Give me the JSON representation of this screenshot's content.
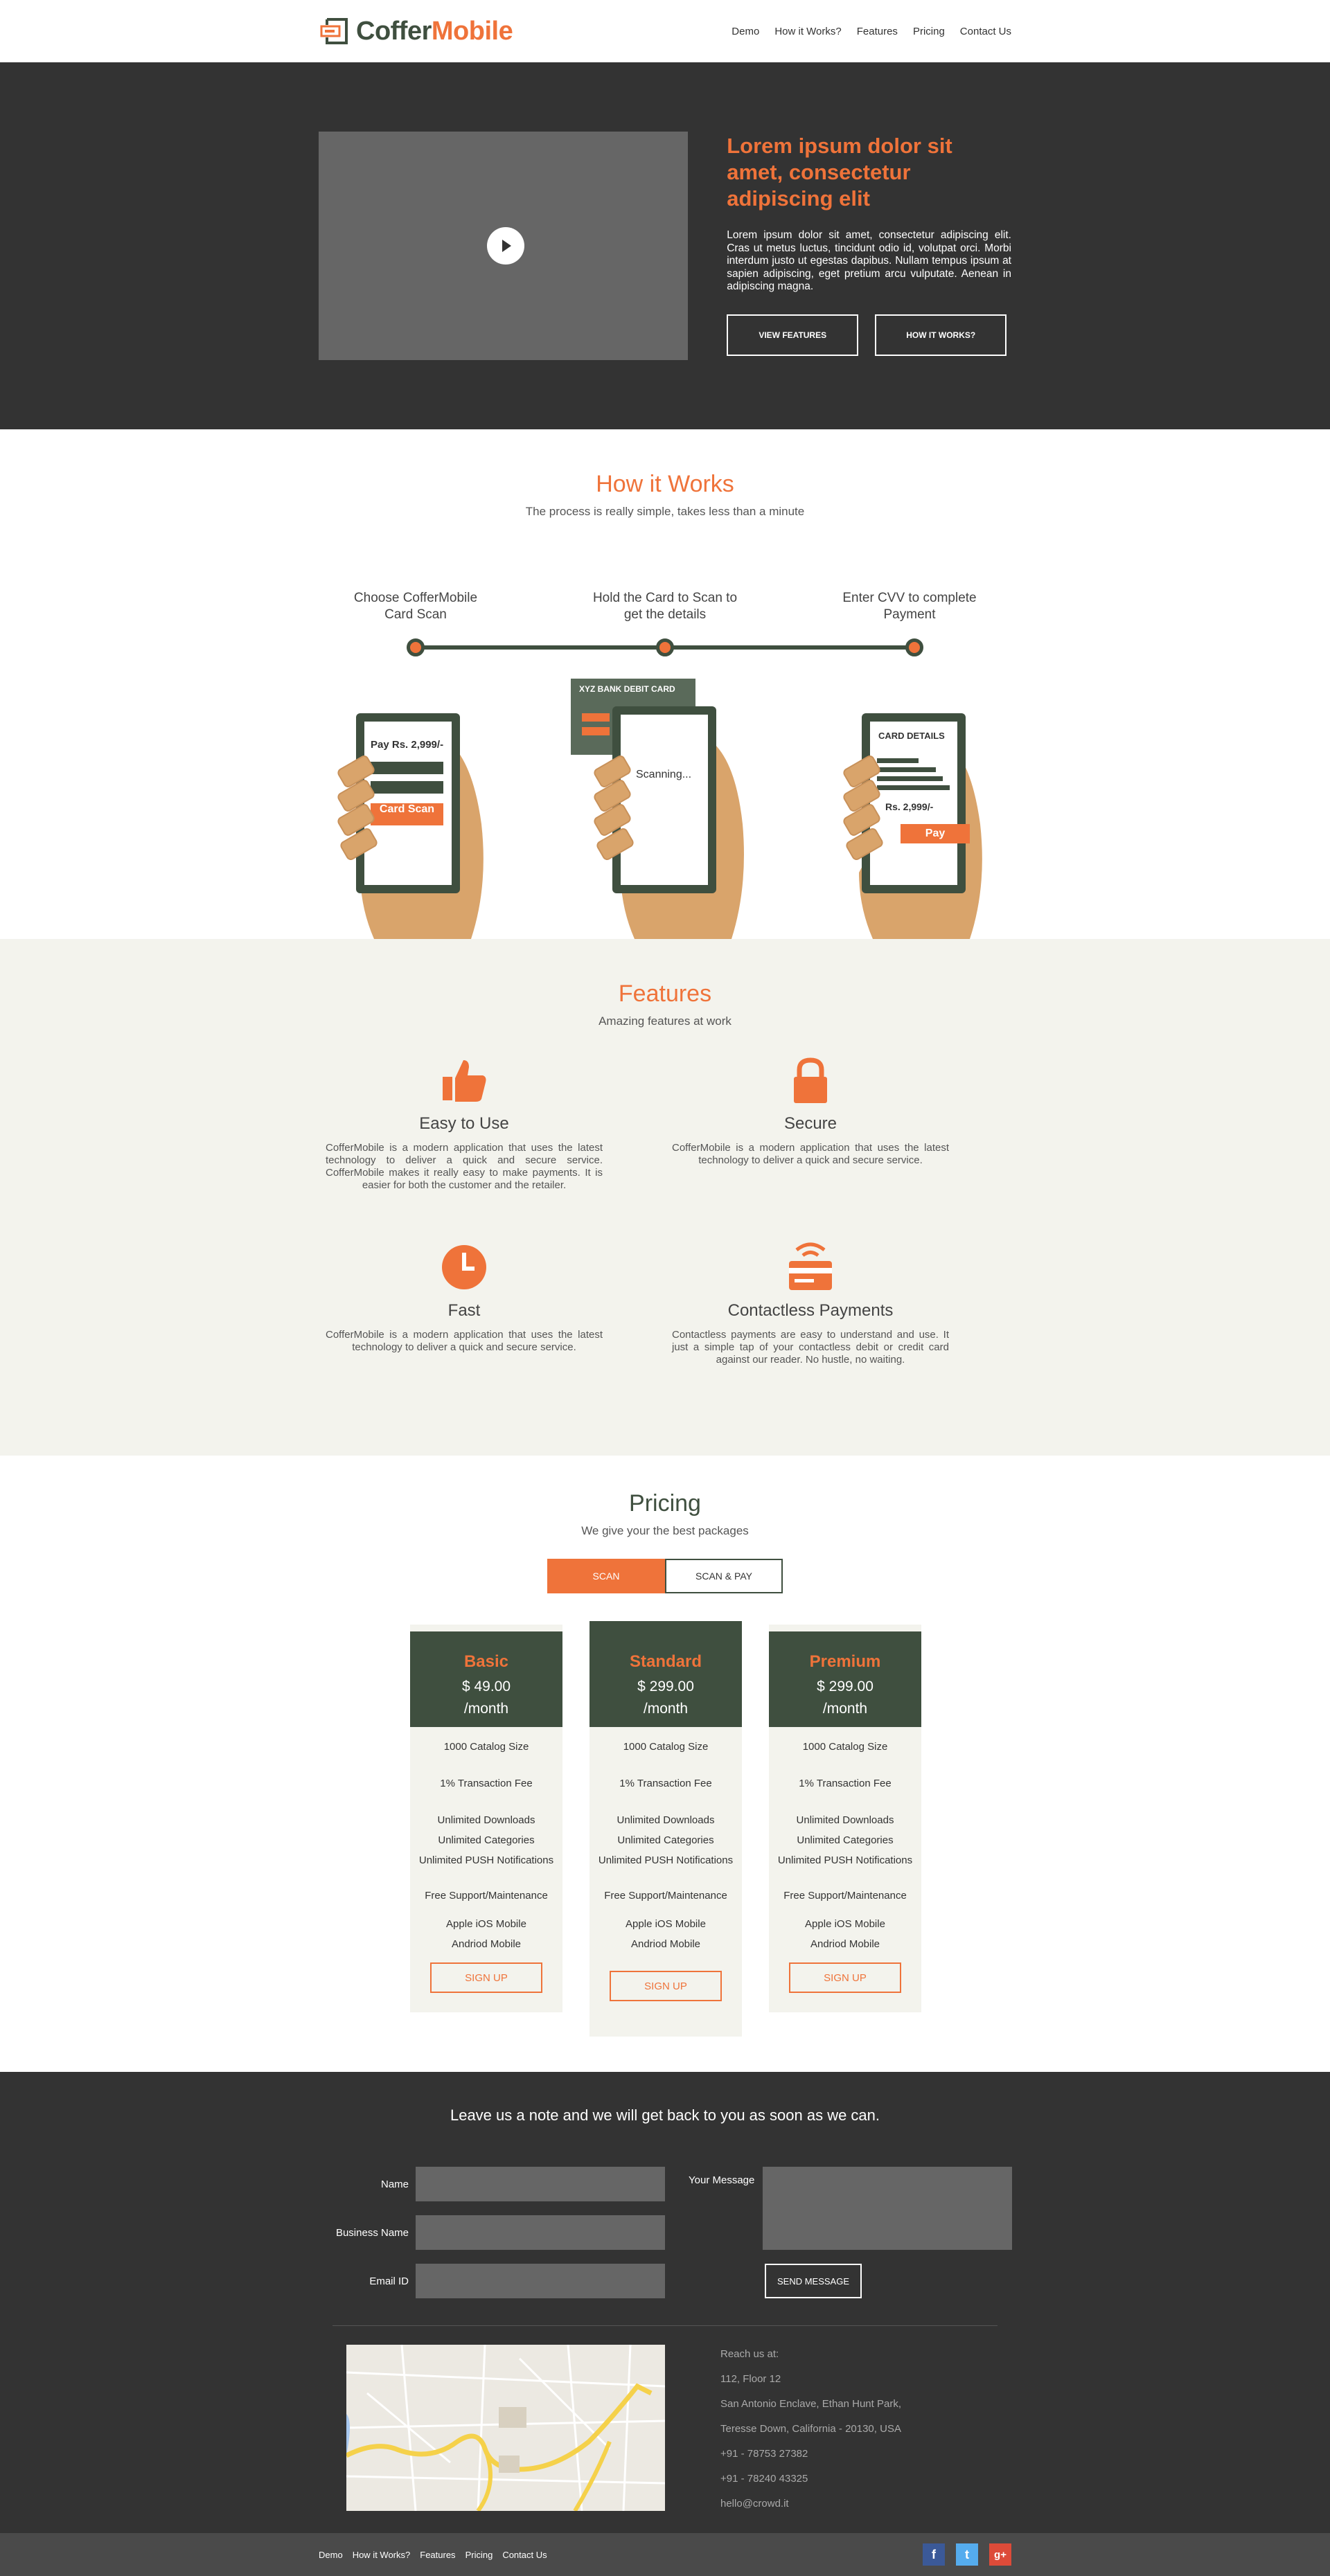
{
  "brand": {
    "name_part1": "Coffer",
    "name_part2": "Mobile"
  },
  "nav": [
    "Demo",
    "How it Works?",
    "Features",
    "Pricing",
    "Contact Us"
  ],
  "hero": {
    "title": "Lorem ipsum dolor sit amet, consectetur adipiscing elit",
    "body": "Lorem ipsum dolor sit amet, consectetur adipiscing elit. Cras ut metus luctus, tincidunt odio id, volutpat orci. Morbi interdum justo ut egestas dapibus. Nullam tempus ipsum at sapien adipiscing, eget pretium arcu vulputate. Aenean in adipiscing magna.",
    "btn_features": "VIEW FEATURES",
    "btn_how": "HOW IT WORKS?"
  },
  "how": {
    "title": "How it Works",
    "subtitle": "The process is really simple, takes less than a minute",
    "steps": [
      "Choose CofferMobile Card Scan",
      "Hold the Card to Scan to get the details",
      "Enter CVV to complete Payment"
    ],
    "phone1": {
      "price": "Pay Rs. 2,999/-",
      "button": "Card Scan"
    },
    "phone2": {
      "card": "XYZ BANK DEBIT CARD",
      "status": "Scanning..."
    },
    "phone3": {
      "title": "CARD DETAILS",
      "amount": "Rs. 2,999/-",
      "button": "Pay"
    }
  },
  "features": {
    "title": "Features",
    "subtitle": "Amazing features at work",
    "items": [
      {
        "title": "Easy to Use",
        "text": "CofferMobile is a modern application that uses the latest technology to deliver a quick and secure service. CofferMobile makes it really easy to make payments. It is easier for both the customer and the retailer.",
        "icon": "thumbs-up-icon"
      },
      {
        "title": "Secure",
        "text": "CofferMobile is a modern application that uses the latest technology to deliver a quick and secure service.",
        "icon": "lock-icon"
      },
      {
        "title": "Fast",
        "text": "CofferMobile is a modern application that uses the latest technology to deliver a quick and secure service.",
        "icon": "clock-icon"
      },
      {
        "title": "Contactless Payments",
        "text": "Contactless payments are easy to understand and use. It just a simple tap of your contactless debit or credit card against our reader. No hustle, no waiting.",
        "icon": "contactless-card-icon"
      }
    ]
  },
  "pricing": {
    "title": "Pricing",
    "subtitle": "We give your the best packages",
    "tabs": [
      "SCAN",
      "SCAN & PAY"
    ],
    "plans": [
      {
        "name": "Basic",
        "price": "$ 49.00",
        "period": "/month"
      },
      {
        "name": "Standard",
        "price": "$ 299.00",
        "period": "/month"
      },
      {
        "name": "Premium",
        "price": "$ 299.00",
        "period": "/month"
      }
    ],
    "plan_features": [
      "1000 Catalog Size",
      "1% Transaction Fee",
      "Unlimited Downloads",
      "Unlimited Categories",
      "Unlimited PUSH Notifications",
      "Free Support/Maintenance",
      "Apple iOS Mobile",
      "Andriod Mobile"
    ],
    "signup": "SIGN UP"
  },
  "contact": {
    "heading": "Leave us a note and we will get back to you as soon as we can.",
    "name": "Name",
    "business": "Business Name",
    "email": "Email ID",
    "message": "Your Message",
    "send": "SEND MESSAGE",
    "address": [
      "Reach us at:",
      "112, Floor 12",
      "San Antonio Enclave, Ethan Hunt Park,",
      "Teresse Down, California - 20130, USA",
      "+91 - 78753 27382",
      "+91 - 78240 43325",
      "hello@crowd.it"
    ]
  },
  "footer": {
    "nav": [
      "Demo",
      "How it Works?",
      "Features",
      "Pricing",
      "Contact Us"
    ],
    "social": [
      "f",
      "t",
      "g+"
    ]
  },
  "colors": {
    "accent": "#ef733a",
    "dark_green": "#3f4f3f",
    "dark": "#333333",
    "light": "#f3f3ed",
    "facebook": "#3b5998",
    "twitter": "#55acee",
    "gplus": "#dd4b39"
  }
}
